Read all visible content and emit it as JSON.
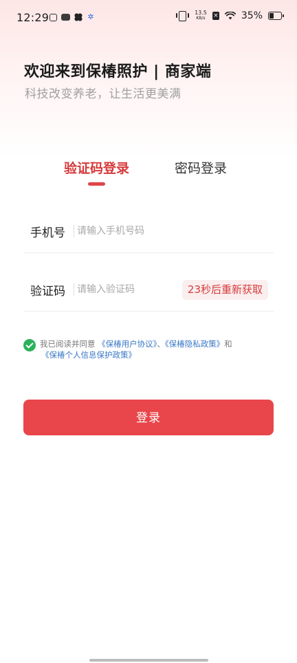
{
  "status_bar": {
    "time": "12:29",
    "net_speed_value": "13.5",
    "net_speed_unit": "KB/s",
    "battery_percent": "35%",
    "battery_level": 0.35,
    "icons": [
      "app-leaf-icon",
      "app-box-icon",
      "app-clover-icon",
      "settings-gear-icon",
      "vibrate-icon",
      "no-sim-icon",
      "wifi-icon",
      "battery-icon"
    ]
  },
  "header": {
    "title": "欢迎来到保椿照护 | 商家端",
    "subtitle": "科技改变养老，让生活更美满"
  },
  "tabs": [
    {
      "label": "验证码登录",
      "active": true
    },
    {
      "label": "密码登录",
      "active": false
    }
  ],
  "form": {
    "phone": {
      "label": "手机号",
      "placeholder": "请输入手机号码",
      "value": ""
    },
    "code": {
      "label": "验证码",
      "placeholder": "请输入验证码",
      "value": "",
      "resend_label": "23秒后重新获取"
    }
  },
  "agreement": {
    "checked": true,
    "prefix": "我已阅读并同意",
    "user_agreement": "《保椿用户协议》",
    "separator": "、",
    "privacy_policy": "《保椿隐私政策》",
    "conjunction": "和",
    "personal_info_policy": "《保椿个人信息保护政策》"
  },
  "login_button": {
    "label": "登录"
  },
  "colors": {
    "accent": "#e8464a",
    "active_tab": "#d6393a",
    "link": "#3a78c6",
    "check": "#2ab15a"
  }
}
